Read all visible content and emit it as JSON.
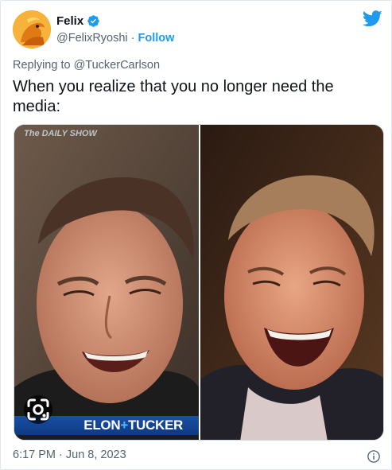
{
  "author": {
    "display_name": "Felix",
    "handle": "@FelixRyoshi",
    "separator": "·",
    "follow_label": "Follow",
    "verified": true
  },
  "reply": {
    "prefix": "Replying to",
    "mention": "@TuckerCarlson"
  },
  "tweet": {
    "text": "When you realize that you no longer need the media:"
  },
  "media": {
    "left_photo": {
      "watermark": "The DAILY SHOW",
      "caption_left": "ELON",
      "caption_plus": "+",
      "caption_right": "TUCKER"
    },
    "lens_icon": "google-lens-icon"
  },
  "footer": {
    "timestamp": "6:17 PM · Jun 8, 2023",
    "info_icon": "info-icon"
  },
  "colors": {
    "accent": "#1d9bf0",
    "text_primary": "#0f1419",
    "text_secondary": "#536471",
    "caption_bar": "#1a4fa3"
  },
  "icons": {
    "brand": "twitter-bird-icon",
    "verified": "verified-badge-icon"
  }
}
